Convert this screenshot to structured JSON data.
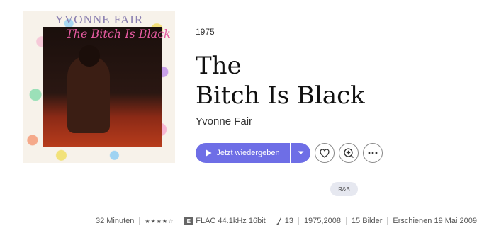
{
  "album": {
    "cover_title": "YVONNE FAIR",
    "cover_script": "The Bitch Is Black",
    "year": "1975",
    "title_line1": "The",
    "title_line2": "Bitch Is Black",
    "artist": "Yvonne Fair"
  },
  "actions": {
    "play_label": "Jetzt wiedergeben",
    "play_icon": "play-icon",
    "caret_icon": "chevron-down-icon",
    "favorite_icon": "heart-icon",
    "add_icon": "add-circle-icon",
    "more_icon": "more-icon"
  },
  "genre": "R&B",
  "info": {
    "duration": "32 Minuten",
    "rating": 4.5,
    "explicit": "E",
    "quality": "FLAC 44.1kHz 16bit",
    "tracks": "13",
    "years": "1975,2008",
    "images": "15 Bilder",
    "released": "Erschienen 19 Mai 2009"
  },
  "colors": {
    "accent": "#6e6ee6",
    "genre_bg": "#e6e8f0"
  }
}
